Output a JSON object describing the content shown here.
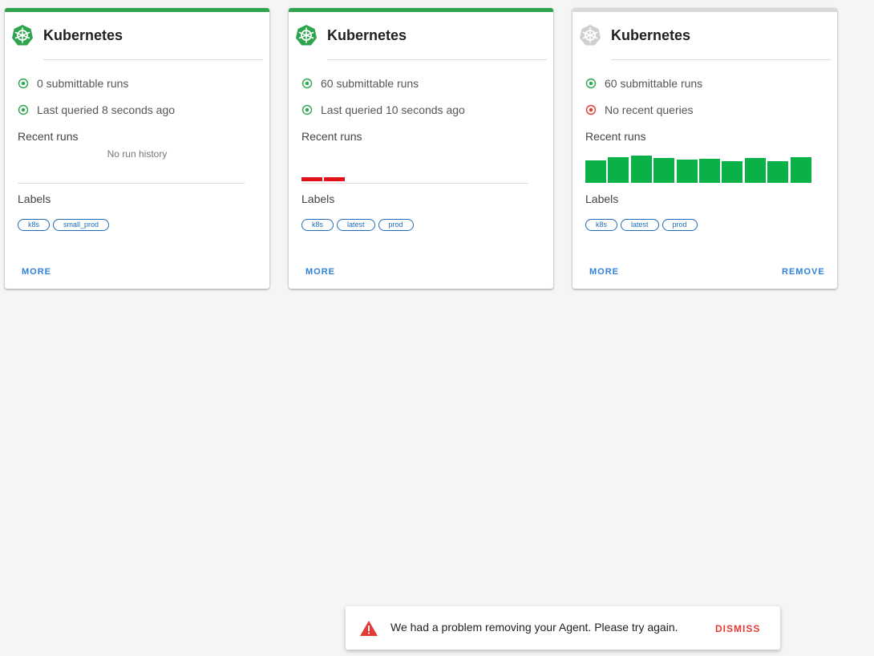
{
  "colors": {
    "accent_green": "#2ea44f",
    "run_success": "#0ab146",
    "run_failed": "#e0101a",
    "link_blue": "#2f80d9",
    "error_red": "#e53935"
  },
  "cards": [
    {
      "icon": "kubernetes-icon",
      "title": "Kubernetes",
      "active": true,
      "submittable": "0 submittable runs",
      "query_status": "Last queried 8 seconds ago",
      "query_ok": true,
      "recent_runs_label": "Recent runs",
      "no_history": "No run history",
      "runs": [],
      "labels_label": "Labels",
      "labels": [
        "k8s",
        "small_prod"
      ],
      "more": "MORE",
      "remove": ""
    },
    {
      "icon": "kubernetes-icon",
      "title": "Kubernetes",
      "active": true,
      "submittable": "60 submittable runs",
      "query_status": "Last queried 10 seconds ago",
      "query_ok": true,
      "recent_runs_label": "Recent runs",
      "no_history": "",
      "runs": [
        {
          "state": "failed",
          "value": 0.15
        },
        {
          "state": "failed",
          "value": 0.15
        }
      ],
      "labels_label": "Labels",
      "labels": [
        "k8s",
        "latest",
        "prod"
      ],
      "more": "MORE",
      "remove": ""
    },
    {
      "icon": "kubernetes-icon",
      "title": "Kubernetes",
      "active": false,
      "submittable": "60 submittable runs",
      "query_status": "No recent queries",
      "query_ok": false,
      "recent_runs_label": "Recent runs",
      "no_history": "",
      "runs": [
        {
          "state": "success",
          "value": 0.82
        },
        {
          "state": "success",
          "value": 0.94
        },
        {
          "state": "success",
          "value": 1.0
        },
        {
          "state": "success",
          "value": 0.91
        },
        {
          "state": "success",
          "value": 0.85
        },
        {
          "state": "success",
          "value": 0.88
        },
        {
          "state": "success",
          "value": 0.8
        },
        {
          "state": "success",
          "value": 0.91
        },
        {
          "state": "success",
          "value": 0.79
        },
        {
          "state": "success",
          "value": 0.94
        }
      ],
      "labels_label": "Labels",
      "labels": [
        "k8s",
        "latest",
        "prod"
      ],
      "more": "MORE",
      "remove": "REMOVE"
    }
  ],
  "snackbar": {
    "icon": "warning-icon",
    "message": "We had a problem removing your Agent. Please try again.",
    "dismiss": "DISMISS"
  }
}
